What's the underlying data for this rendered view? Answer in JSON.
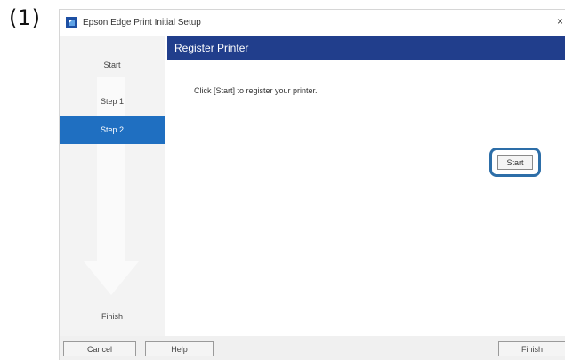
{
  "figure_label": "(1)",
  "window": {
    "title": "Epson Edge Print Initial Setup",
    "close_glyph": "×",
    "icon": "epson-app-icon"
  },
  "sidebar": {
    "items": [
      {
        "label": "Start",
        "active": false
      },
      {
        "label": "Step 1",
        "active": false
      },
      {
        "label": "Step 2",
        "active": true
      },
      {
        "label": "Finish",
        "active": false
      }
    ],
    "active_color": "#1f6fc1",
    "background_color": "#f3f3f3"
  },
  "header": {
    "title": "Register Printer",
    "background_color": "#213e8c"
  },
  "main": {
    "instruction": "Click [Start] to register your printer.",
    "start_label": "Start",
    "highlight_color": "#2d6ea8"
  },
  "footer": {
    "cancel_label": "Cancel",
    "help_label": "Help",
    "finish_label": "Finish"
  }
}
